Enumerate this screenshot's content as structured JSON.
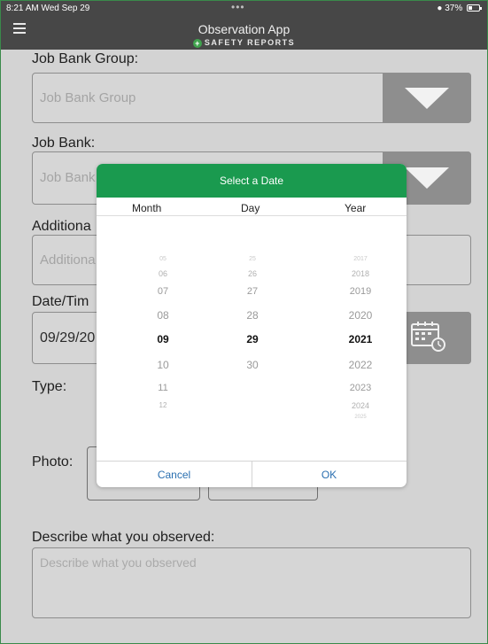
{
  "status_bar": {
    "time": "8:21 AM  Wed Sep 29",
    "dots": "•••",
    "battery": "37%"
  },
  "nav": {
    "title": "Observation App",
    "subtitle": "SAFETY REPORTS"
  },
  "job_bank_group": {
    "label": "Job Bank Group:",
    "placeholder": "Job Bank Group"
  },
  "job_bank": {
    "label": "Job Bank:",
    "placeholder": "Job Bank"
  },
  "additional": {
    "label": "Additiona",
    "placeholder": "Additiona"
  },
  "datetime": {
    "label": "Date/Tim",
    "value": "09/29/20"
  },
  "type": {
    "label": "Type:"
  },
  "photo": {
    "label": "Photo:"
  },
  "describe": {
    "label": "Describe what you observed:",
    "placeholder": "Describe what you observed"
  },
  "date_picker": {
    "title": "Select a Date",
    "col_month": "Month",
    "col_day": "Day",
    "col_year": "Year",
    "months": [
      "05",
      "06",
      "07",
      "08",
      "09",
      "10",
      "11",
      "12"
    ],
    "days": [
      "25",
      "26",
      "27",
      "28",
      "29",
      "30"
    ],
    "years": [
      "2017",
      "2018",
      "2019",
      "2020",
      "2021",
      "2022",
      "2023",
      "2024",
      "2025"
    ],
    "selected": {
      "month": "09",
      "day": "29",
      "year": "2021"
    },
    "cancel": "Cancel",
    "ok": "OK"
  }
}
